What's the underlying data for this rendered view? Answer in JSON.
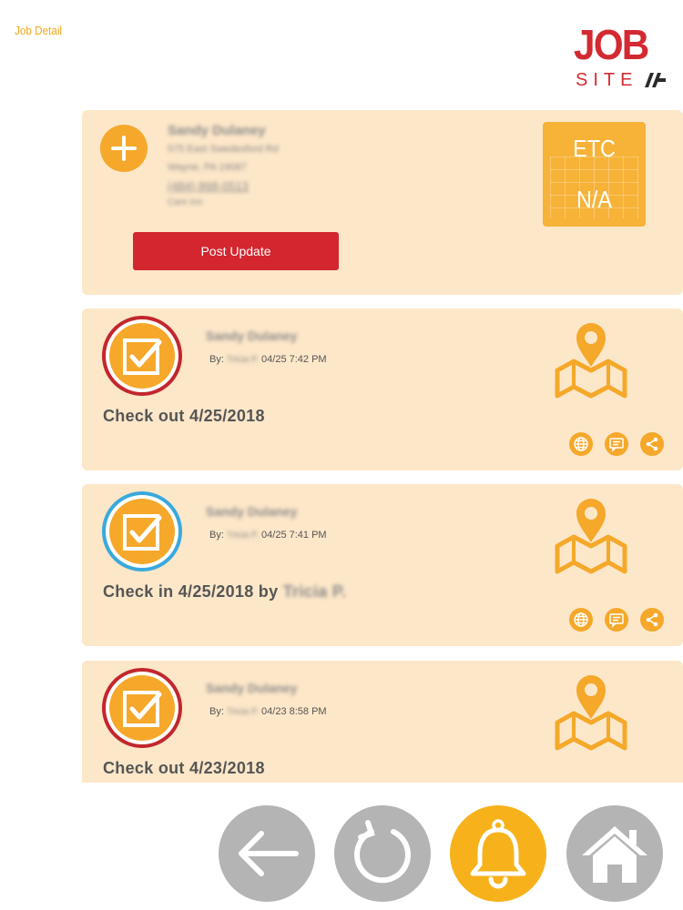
{
  "header": {
    "title": "Job Detail",
    "logo_top": "JOB",
    "logo_bottom": "SITE"
  },
  "job": {
    "contact_name": "Sandy Dulaney",
    "address_line1": "575 East Swedesford Rd",
    "address_line2": "Wayne, PA 19087",
    "phone": "(484) 868-0513",
    "note": "Care Inn",
    "post_update_label": "Post Update",
    "etc_label": "ETC",
    "etc_value": "N/A"
  },
  "activities": [
    {
      "status": "check-out",
      "ring_color": "#c2272d",
      "name": "Sandy Dulaney",
      "by_label": "By:",
      "by_user": "Tricia P.",
      "timestamp": "04/25 7:42 PM",
      "title": "Check out 4/25/2018",
      "title_suffix": ""
    },
    {
      "status": "check-in",
      "ring_color": "#39a9dc",
      "name": "Sandy Dulaney",
      "by_label": "By:",
      "by_user": "Tricia P.",
      "timestamp": "04/25 7:41 PM",
      "title": "Check in 4/25/2018 by",
      "title_suffix": "Tricia P."
    },
    {
      "status": "check-out",
      "ring_color": "#c2272d",
      "name": "Sandy Dulaney",
      "by_label": "By:",
      "by_user": "Tricia P.",
      "timestamp": "04/23 8:58 PM",
      "title": "Check out 4/23/2018",
      "title_suffix": ""
    }
  ],
  "activity_actions": [
    "globe-icon",
    "message-icon",
    "share-icon"
  ],
  "nav": [
    {
      "name": "back",
      "icon": "arrow-left-icon",
      "active": false
    },
    {
      "name": "refresh",
      "icon": "refresh-icon",
      "active": false
    },
    {
      "name": "notifications",
      "icon": "bell-icon",
      "active": true
    },
    {
      "name": "home",
      "icon": "home-icon",
      "active": false
    }
  ],
  "colors": {
    "accent": "#f5a82a",
    "brand_red": "#d3262f",
    "card_bg": "#fde7c9",
    "check_in_ring": "#39a9dc",
    "check_out_ring": "#c2272d",
    "nav_inactive": "#b4b4b4",
    "nav_active": "#f7b21b"
  }
}
